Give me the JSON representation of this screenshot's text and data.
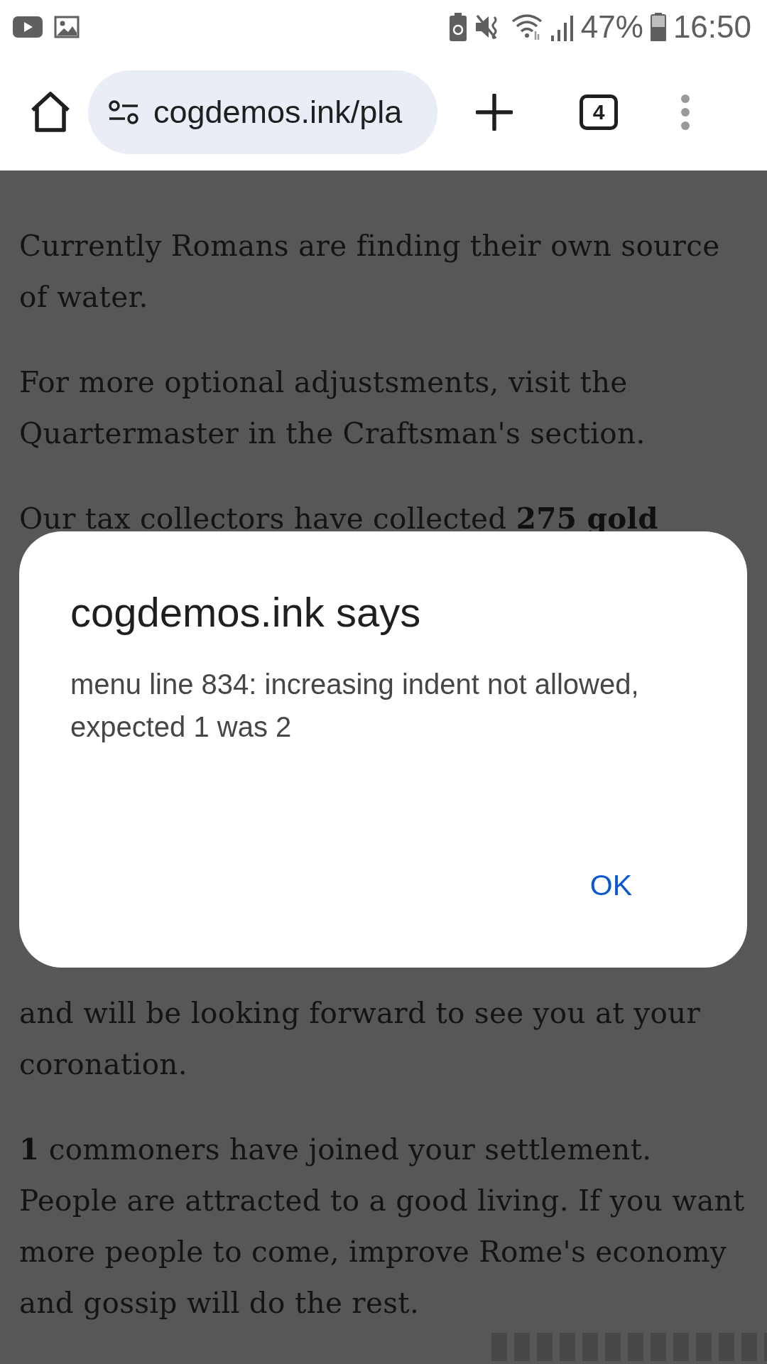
{
  "status_bar": {
    "battery_percent": "47%",
    "time": "16:50"
  },
  "browser_toolbar": {
    "url": "cogdemos.ink/pla",
    "tab_count": "4"
  },
  "page": {
    "paragraphs": [
      {
        "text": "Currently Romans are finding their own source of water."
      },
      {
        "text": "For more optional adjustsments, visit the Quartermaster in the Craftsman's section."
      },
      {
        "text": "Our tax collectors have collected **275 gold**"
      },
      {
        "text": "and will be looking forward to see you at your coronation."
      },
      {
        "text": "**1** commoners have joined your settlement. People are attracted to a good living. If you want more people to come, improve Rome's economy and gossip will do the rest."
      }
    ]
  },
  "dialog": {
    "title": "cogdemos.ink says",
    "message": "menu line 834: increasing indent not allowed, expected 1 was 2",
    "button": "OK"
  }
}
